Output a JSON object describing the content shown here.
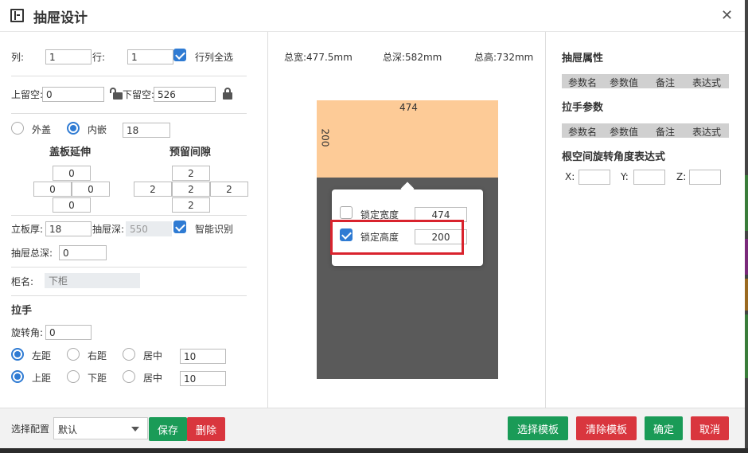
{
  "title": "抽屉设计",
  "left": {
    "col_label": "列:",
    "col_value": "1",
    "row_label": "行:",
    "row_value": "1",
    "select_all_label": "行列全选",
    "top_margin_label": "上留空:",
    "top_margin_value": "0",
    "bottom_margin_label": "下留空:",
    "bottom_margin_value": "526",
    "outer_label": "外盖",
    "inner_label": "内嵌",
    "inner_value": "18",
    "cover_ext_title": "盖板延伸",
    "cover_ext": {
      "top": "0",
      "left": "0",
      "right": "0",
      "bottom": "0"
    },
    "gap_title": "预留间隙",
    "gap": {
      "top": "2",
      "left": "2",
      "center": "2",
      "right": "2",
      "bottom": "2"
    },
    "board_thick_label": "立板厚:",
    "board_thick_value": "18",
    "drawer_depth_label": "抽屉深:",
    "drawer_depth_value": "550",
    "smart_label": "智能识别",
    "total_depth_label": "抽屉总深:",
    "total_depth_value": "0",
    "cabinet_name_label": "柜名:",
    "cabinet_name_placeholder": "下柜",
    "handle_title": "拉手",
    "rotate_label": "旋转角:",
    "rotate_value": "0",
    "h_left": "左距",
    "h_right": "右距",
    "h_center": "居中",
    "h_value": "10",
    "v_top": "上距",
    "v_bottom": "下距",
    "v_center": "居中",
    "v_value": "10"
  },
  "center": {
    "total_width": "总宽:477.5mm",
    "total_depth": "总深:582mm",
    "total_height": "总高:732mm",
    "width_dim": "474",
    "height_dim": "200",
    "lock_width_label": "锁定宽度",
    "lock_width_value": "474",
    "lock_height_label": "锁定高度",
    "lock_height_value": "200"
  },
  "right": {
    "drawer_props_title": "抽屉属性",
    "handle_params_title": "拉手参数",
    "rotation_expr_title": "根空间旋转角度表达式",
    "col_param_name": "参数名",
    "col_param_value": "参数值",
    "col_note": "备注",
    "col_expr": "表达式",
    "x_label": "X:",
    "y_label": "Y:",
    "z_label": "Z:"
  },
  "footer": {
    "config_label": "选择配置",
    "config_value": "默认",
    "save": "保存",
    "delete": "删除",
    "select_template": "选择模板",
    "clear_template": "清除模板",
    "confirm": "确定",
    "cancel": "取消"
  }
}
